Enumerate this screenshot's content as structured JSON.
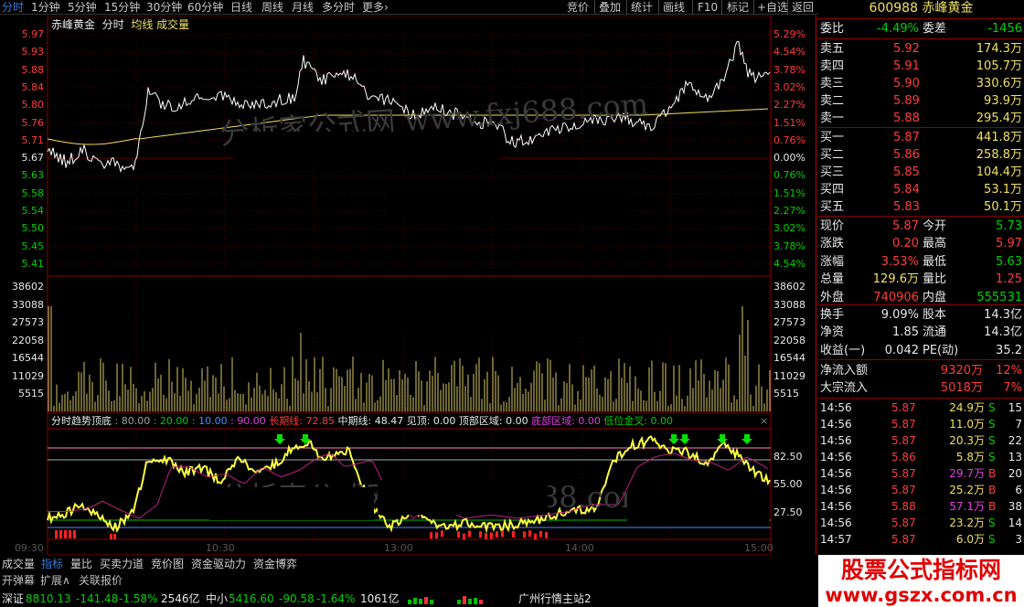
{
  "toolbar": {
    "left": [
      "分时",
      "1分钟",
      "5分钟",
      "15分钟",
      "30分钟",
      "60分钟",
      "日线",
      "周线",
      "月线",
      "多分时",
      "更多"
    ],
    "right": [
      "竞价",
      "叠加",
      "统计",
      "画线",
      "F10",
      "标记",
      "+自选",
      "返回"
    ]
  },
  "stock": {
    "code": "600988",
    "name": "赤峰黄金"
  },
  "main_chart": {
    "title_name": "赤峰黄金",
    "title_mode": "分时",
    "title_avg": "均线",
    "title_vol": "成交量",
    "price_labels": [
      "5.97",
      "5.93",
      "5.88",
      "5.84",
      "5.80",
      "5.76",
      "5.71",
      "5.67",
      "5.63",
      "5.58",
      "5.54",
      "5.50",
      "5.45",
      "5.41"
    ],
    "pct_labels": [
      "5.29%",
      "4.54%",
      "3.78%",
      "3.02%",
      "2.27%",
      "1.51%",
      "0.76%",
      "0.00%",
      "0.76%",
      "1.51%",
      "2.27%",
      "3.02%",
      "3.78%",
      "4.54%"
    ],
    "vol_labels": [
      "38602",
      "33088",
      "27573",
      "22058",
      "16544",
      "11029",
      "5515"
    ]
  },
  "indicator": {
    "name": "分时趋势顶底",
    "values": [
      {
        "text": ": 80.00",
        "color": "#a0a0a0"
      },
      {
        "text": ": 20.00",
        "color": "#00d000"
      },
      {
        "text": ": 10.00",
        "color": "#4a8cff"
      },
      {
        "text": ": 90.00",
        "color": "#e040e0"
      }
    ],
    "long_label": "长期线: 72.85",
    "mid_label": "中期线: 48.47",
    "jd_label": "见顶: 0.00",
    "top_label": "顶部区域: 0.00",
    "bottom_label": "底部区域: 0.00",
    "gold_label": "低位金叉: 0.00",
    "right_labels": [
      "82.50",
      "55.00",
      "27.50"
    ]
  },
  "time_axis": [
    "09:30",
    "10:30",
    "13:00",
    "14:00",
    "15:00"
  ],
  "quote": {
    "wb": {
      "label": "委比",
      "value": "-4.49%",
      "label2": "委差",
      "value2": "-1456"
    },
    "sell": [
      {
        "label": "卖五",
        "price": "5.92",
        "vol": "174.3万"
      },
      {
        "label": "卖四",
        "price": "5.91",
        "vol": "105.7万"
      },
      {
        "label": "卖三",
        "price": "5.90",
        "vol": "330.6万"
      },
      {
        "label": "卖二",
        "price": "5.89",
        "vol": "93.9万"
      },
      {
        "label": "卖一",
        "price": "5.88",
        "vol": "295.4万"
      }
    ],
    "buy": [
      {
        "label": "买一",
        "price": "5.87",
        "vol": "441.8万"
      },
      {
        "label": "买二",
        "price": "5.86",
        "vol": "258.8万"
      },
      {
        "label": "买三",
        "price": "5.85",
        "vol": "104.4万"
      },
      {
        "label": "买四",
        "price": "5.84",
        "vol": "53.1万"
      },
      {
        "label": "买五",
        "price": "5.83",
        "vol": "50.1万"
      }
    ],
    "stats": [
      {
        "l1": "现价",
        "v1": "5.87",
        "c1": "#ff3c3c",
        "l2": "今开",
        "v2": "5.73",
        "c2": "#00d000"
      },
      {
        "l1": "涨跌",
        "v1": "0.20",
        "c1": "#ff3c3c",
        "l2": "最高",
        "v2": "5.97",
        "c2": "#ff3c3c"
      },
      {
        "l1": "涨幅",
        "v1": "3.53%",
        "c1": "#ff3c3c",
        "l2": "最低",
        "v2": "5.63",
        "c2": "#00d000"
      },
      {
        "l1": "总量",
        "v1": "129.6万",
        "c1": "#f0e060",
        "l2": "量比",
        "v2": "1.25",
        "c2": "#ff3c3c"
      },
      {
        "l1": "外盘",
        "v1": "740906",
        "c1": "#ff3c3c",
        "l2": "内盘",
        "v2": "555531",
        "c2": "#00d000"
      }
    ],
    "stats2": [
      {
        "l1": "换手",
        "v1": "9.09%",
        "c1": "#e8e8e8",
        "l2": "股本",
        "v2": "14.3亿",
        "c2": "#e8e8e8"
      },
      {
        "l1": "净资",
        "v1": "1.85",
        "c1": "#e8e8e8",
        "l2": "流通",
        "v2": "14.3亿",
        "c2": "#e8e8e8"
      },
      {
        "l1": "收益(一)",
        "v1": "0.042",
        "c1": "#e8e8e8",
        "l2": "PE(动)",
        "v2": "35.2",
        "c2": "#e8e8e8"
      }
    ],
    "flow": [
      {
        "label": "净流入额",
        "value": "9320万",
        "pct": "12%"
      },
      {
        "label": "大宗流入",
        "value": "5018万",
        "pct": "7%"
      }
    ],
    "ticks": [
      {
        "t": "14:56",
        "p": "5.87",
        "pc": "#ff3c3c",
        "v": "24.9万",
        "vc": "#f0e060",
        "d": "S",
        "dc": "#00d000",
        "n": "15"
      },
      {
        "t": "14:56",
        "p": "5.87",
        "pc": "#ff3c3c",
        "v": "11.0万",
        "vc": "#f0e060",
        "d": "S",
        "dc": "#00d000",
        "n": "7"
      },
      {
        "t": "14:56",
        "p": "5.87",
        "pc": "#ff3c3c",
        "v": "20.3万",
        "vc": "#f0e060",
        "d": "S",
        "dc": "#00d000",
        "n": "22"
      },
      {
        "t": "14:56",
        "p": "5.86",
        "pc": "#ff3c3c",
        "v": "5.8万",
        "vc": "#f0e060",
        "d": "S",
        "dc": "#00d000",
        "n": "13"
      },
      {
        "t": "14:56",
        "p": "5.87",
        "pc": "#ff3c3c",
        "v": "29.7万",
        "vc": "#e040e0",
        "d": "B",
        "dc": "#ff3c3c",
        "n": "20"
      },
      {
        "t": "14:56",
        "p": "5.87",
        "pc": "#ff3c3c",
        "v": "25.2万",
        "vc": "#f0e060",
        "d": "B",
        "dc": "#ff3c3c",
        "n": "6"
      },
      {
        "t": "14:56",
        "p": "5.88",
        "pc": "#ff3c3c",
        "v": "57.1万",
        "vc": "#e040e0",
        "d": "B",
        "dc": "#ff3c3c",
        "n": "38"
      },
      {
        "t": "14:56",
        "p": "5.87",
        "pc": "#ff3c3c",
        "v": "23.2万",
        "vc": "#f0e060",
        "d": "S",
        "dc": "#00d000",
        "n": "14"
      },
      {
        "t": "14:57",
        "p": "5.87",
        "pc": "#ff3c3c",
        "v": "6.0万",
        "vc": "#f0e060",
        "d": "S",
        "dc": "#00d000",
        "n": "3"
      }
    ]
  },
  "bottom_tabs": [
    "成交量",
    "指标",
    "量比",
    "买卖力道",
    "竞价图",
    "资金驱动力",
    "资金博弈"
  ],
  "bottom_tabs2": [
    "开弹幕",
    "扩展∧",
    "关联报价"
  ],
  "status": {
    "sz_label": "深证",
    "sz_val": "8810.13",
    "sz_chg": "-141.48",
    "sz_pct": "-1.58%",
    "sz_amt": "2546亿",
    "zx_label": "中小",
    "zx_val": "5416.60",
    "zx_chg": "-90.58",
    "zx_pct": "-1.64%",
    "zx_amt": "1061亿",
    "server": "广州行情主站2"
  },
  "banner": {
    "title": "股票公式指标网",
    "url": "www.gszx.com.cn"
  },
  "watermark": {
    "top": "分析家公式网 www.fxj688.com",
    "bottom": "分析家公式网 www.fxj688.com"
  }
}
